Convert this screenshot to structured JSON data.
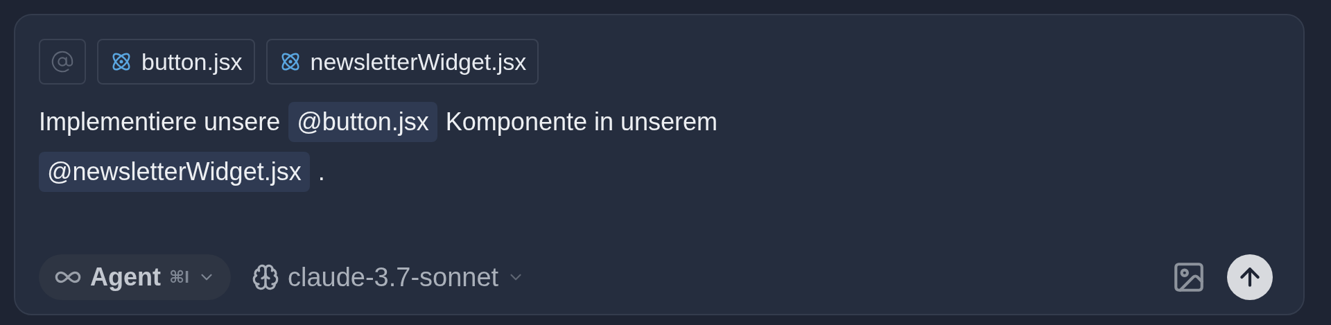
{
  "context_chips": [
    {
      "label": "button.jsx"
    },
    {
      "label": "newsletterWidget.jsx"
    }
  ],
  "prompt_lines": [
    [
      {
        "kind": "text",
        "text": "Implementiere unsere"
      },
      {
        "kind": "mention",
        "text": "@button.jsx"
      },
      {
        "kind": "text",
        "text": "Komponente in unserem"
      }
    ],
    [
      {
        "kind": "mention",
        "text": "@newsletterWidget.jsx"
      },
      {
        "kind": "text",
        "text": "."
      }
    ]
  ],
  "mode": {
    "label": "Agent",
    "shortcut": "⌘I"
  },
  "model": {
    "label": "claude-3.7-sonnet"
  }
}
